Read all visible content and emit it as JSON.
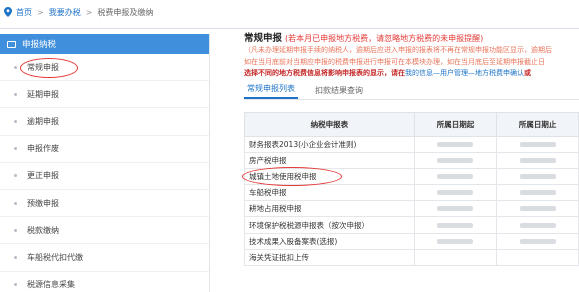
{
  "breadcrumb": {
    "home": "首页",
    "sep1": ">",
    "level2": "我要办税",
    "sep2": ">",
    "level3": "税费申报及缴纳"
  },
  "sidebar": {
    "header": "申报纳税",
    "items": [
      {
        "label": "常规申报",
        "active": true
      },
      {
        "label": "延期申报"
      },
      {
        "label": "逾期申报"
      },
      {
        "label": "申报作废"
      },
      {
        "label": "更正申报"
      },
      {
        "label": "预缴申报"
      },
      {
        "label": "税款缴纳"
      },
      {
        "label": "车船税代扣代缴"
      },
      {
        "label": "税源信息采集"
      }
    ]
  },
  "main": {
    "title": "常规申报",
    "title_hint": "(若本月已申报地方税费，请忽略地方税费的未申报提醒)",
    "notice1": "（凡未办理延期申报手续的纳税人，逾期后应进入申报的报表将不再在常规申报功能区显示，逾期后",
    "notice2": "如在当月底前对当期应申报的税费申报进行申报可在本模块办理，如在当月底后至延期申报截止日",
    "notice3_prefix": "选择不同的地方税费信息将影响申报表的显示，请在",
    "notice3_link": "我的信息—用户管理—地方税费申确认",
    "notice3_suffix": "或",
    "tabs": [
      "常规申报列表",
      "扣款结果查询"
    ]
  },
  "table": {
    "headers": [
      "纳税申报表",
      "所属日期起",
      "所属日期止"
    ],
    "rows": [
      "财务报表2013(小企业会计准则)",
      "房产税申报",
      "城镇土地使用税申报",
      "车船税申报",
      "耕地占用税申报",
      "环境保护税税源申报表（按次申报）",
      "技术成果入股备案表(选报)",
      "海关凭证抵扣上传"
    ]
  },
  "colors": {
    "accent": "#3f8fdc",
    "link": "#1e73c8",
    "warning": "#e53935"
  }
}
